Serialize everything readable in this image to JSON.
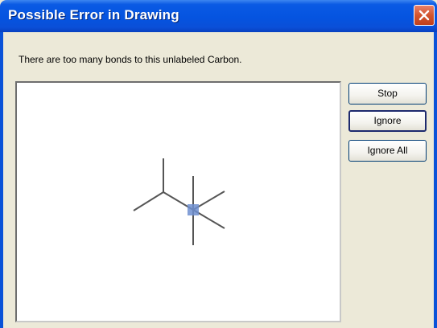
{
  "window": {
    "title": "Possible Error in Drawing",
    "close_icon": "close-icon",
    "message": "There are too many bonds to this unlabeled Carbon."
  },
  "buttons": {
    "stop": "Stop",
    "ignore": "Ignore",
    "ignore_all": "Ignore All"
  },
  "colors": {
    "titlebar": "#0554e0",
    "close_button": "#d2552f",
    "dialog_bg": "#ece9d8",
    "bond_line": "#555555",
    "highlight_atom": "#6f8fd0"
  }
}
